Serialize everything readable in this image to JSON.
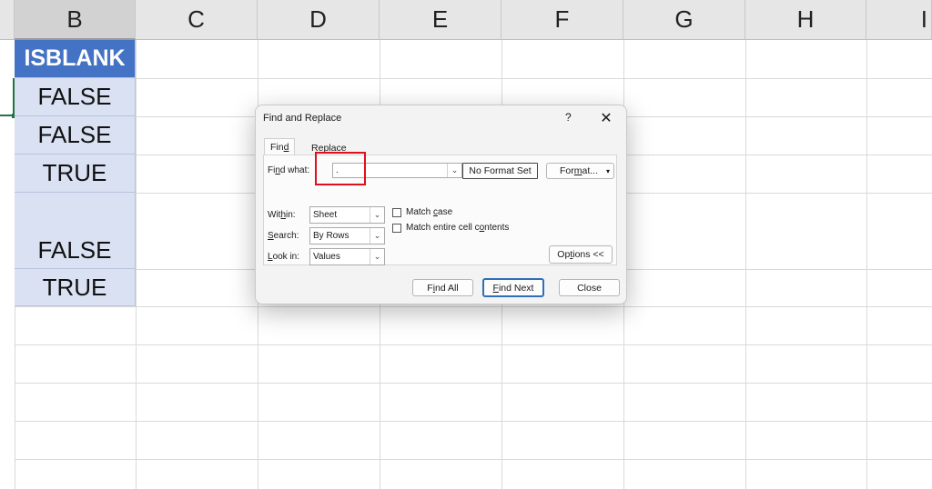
{
  "spreadsheet": {
    "columns": [
      "B",
      "C",
      "D",
      "E",
      "F",
      "G",
      "H",
      "I"
    ],
    "column_b_cells": [
      "ISBLANK",
      "FALSE",
      "FALSE",
      "TRUE",
      "FALSE",
      "TRUE"
    ],
    "header_color": "#4472c4",
    "table_fill_color": "#d9e1f2"
  },
  "dialog": {
    "title": "Find and Replace",
    "help": "?",
    "close": "✕",
    "tabs": [
      {
        "pre": "Fin",
        "key": "d",
        "post": ""
      },
      {
        "pre": "Re",
        "key": "p",
        "post": "lace"
      }
    ],
    "find_what": {
      "pre": "Fi",
      "key": "n",
      "post": "d what:",
      "value": "."
    },
    "no_format_button": "No Format Set",
    "format_button": {
      "pre": "For",
      "key": "m",
      "post": "at..."
    },
    "within": {
      "pre": "Wit",
      "key": "h",
      "post": "in:",
      "value": "Sheet"
    },
    "search": {
      "pre": "",
      "key": "S",
      "post": "earch:",
      "value": "By Rows"
    },
    "look_in": {
      "pre": "",
      "key": "L",
      "post": "ook in:",
      "value": "Values"
    },
    "match_case": {
      "pre": "Match ",
      "key": "c",
      "post": "ase"
    },
    "match_entire": {
      "pre": "Match entire cell c",
      "key": "o",
      "post": "ntents"
    },
    "options_button": {
      "pre": "Op",
      "key": "t",
      "post": "ions <<"
    },
    "find_all_button": {
      "pre": "F",
      "key": "i",
      "post": "nd All"
    },
    "find_next_button": {
      "pre": "",
      "key": "F",
      "post": "ind Next"
    },
    "close_button": "Close",
    "highlight_color": "#e0101a"
  }
}
